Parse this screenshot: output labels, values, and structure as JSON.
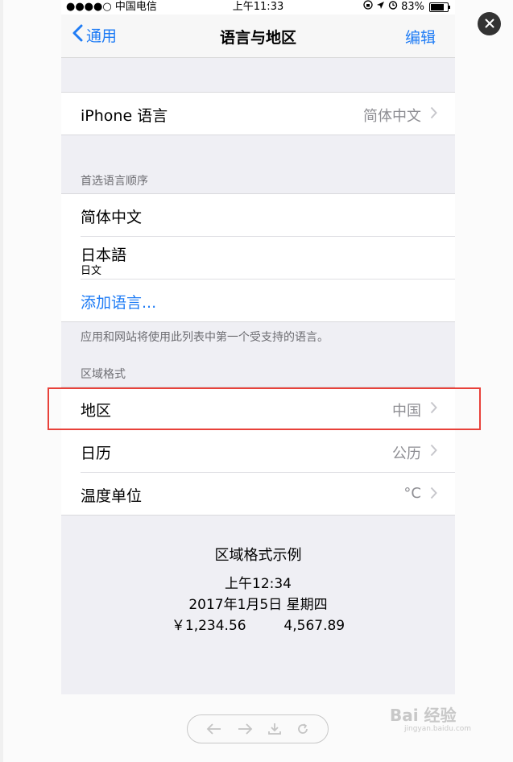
{
  "status_bar": {
    "carrier": "●●●●○ 中国电信",
    "time": "上午11:33",
    "battery": "83%"
  },
  "nav": {
    "back_label": "通用",
    "title": "语言与地区",
    "edit_label": "编辑"
  },
  "iphone_language": {
    "label": "iPhone 语言",
    "value": "简体中文"
  },
  "preferred": {
    "header": "首选语言顺序",
    "items": [
      {
        "label": "简体中文"
      },
      {
        "label": "日本語",
        "sub": "日文"
      }
    ],
    "add_label": "添加语言...",
    "footer": "应用和网站将使用此列表中第一个受支持的语言。"
  },
  "region_format": {
    "header": "区域格式",
    "rows": [
      {
        "label": "地区",
        "value": "中国"
      },
      {
        "label": "日历",
        "value": "公历"
      },
      {
        "label": "温度单位",
        "value": "°C"
      }
    ]
  },
  "sample": {
    "title": "区域格式示例",
    "time": "上午12:34",
    "date": "2017年1月5日 星期四",
    "currency": "￥1,234.56",
    "number": "4,567.89"
  },
  "watermark": {
    "logo": "Bai 经验",
    "url": "jingyan.baidu.com"
  },
  "colors": {
    "accent": "#1f7cf5",
    "highlight_box": "#e8413a"
  }
}
